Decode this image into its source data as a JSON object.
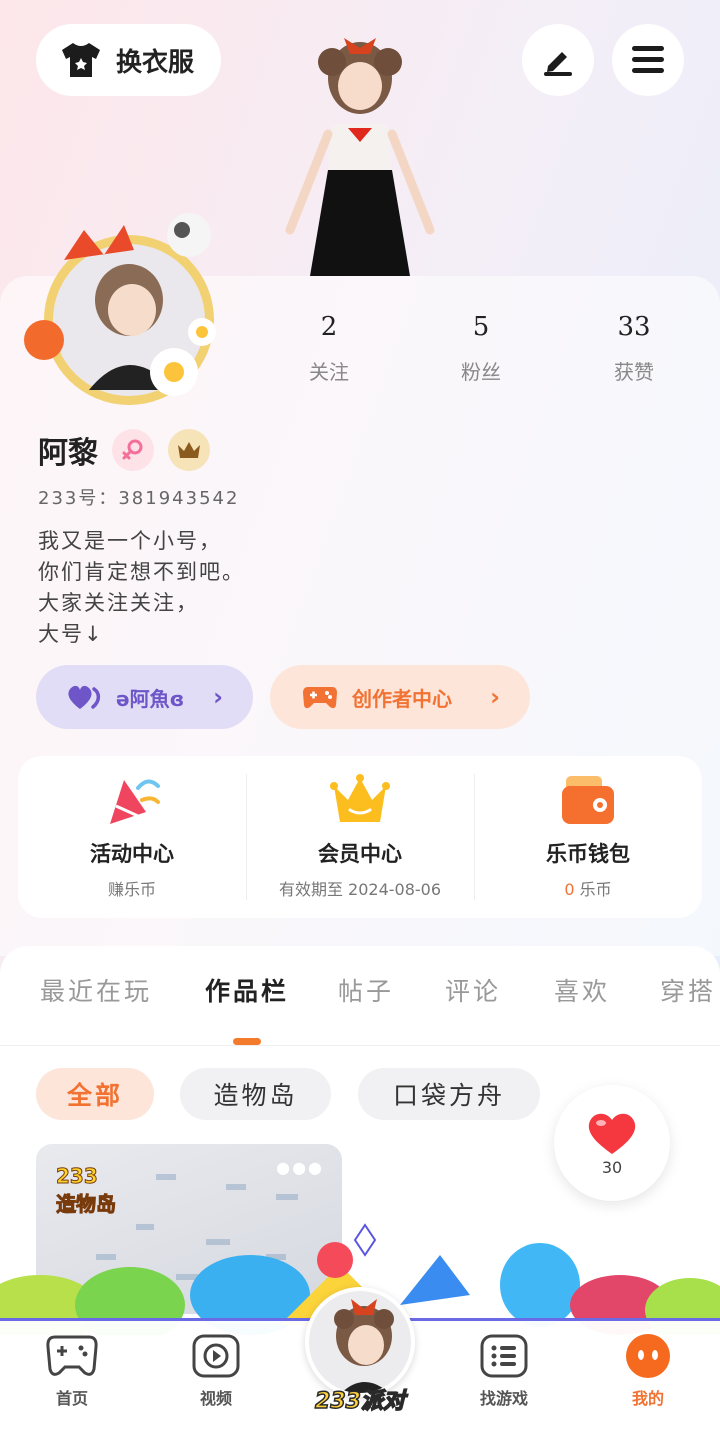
{
  "header": {
    "outfit_label": "换衣服",
    "icons": [
      "tshirt-icon",
      "edit-icon",
      "menu-icon"
    ]
  },
  "profile": {
    "stats": [
      {
        "value": "2",
        "label": "关注"
      },
      {
        "value": "5",
        "label": "粉丝"
      },
      {
        "value": "33",
        "label": "获赞"
      }
    ],
    "name": "阿黎",
    "uid": "233号：381943542",
    "bio": [
      "我又是一个小号，",
      "你们肯定想不到吧。",
      "大家关注关注，",
      "大号↓"
    ],
    "partner_label": "ə阿魚ɞ",
    "creator_label": "创作者中心"
  },
  "services": [
    {
      "title": "活动中心",
      "sub": "赚乐币",
      "icon": "party-popper-icon"
    },
    {
      "title": "会员中心",
      "sub": "有效期至 2024-08-06",
      "icon": "crown-icon"
    },
    {
      "title": "乐币钱包",
      "sub_value": "0",
      "sub_unit": "乐币",
      "icon": "wallet-icon"
    }
  ],
  "tabs": [
    "最近在玩",
    "作品栏",
    "帖子",
    "评论",
    "喜欢",
    "穿搭"
  ],
  "active_tab": "作品栏",
  "chips": [
    "全部",
    "造物岛",
    "口袋方舟"
  ],
  "like_count": "30",
  "work_card": {
    "logo_top": "233",
    "logo_bottom": "造物岛"
  },
  "bottom_nav": [
    {
      "label": "首页",
      "icon": "gamepad-icon"
    },
    {
      "label": "视频",
      "icon": "play-icon"
    },
    {
      "label": "233派对",
      "icon": "avatar"
    },
    {
      "label": "找游戏",
      "icon": "list-icon"
    },
    {
      "label": "我的",
      "icon": "profile-icon"
    }
  ],
  "colors": {
    "accent": "#f17232",
    "purple": "#6e55c8",
    "nav_border": "#6b6ae6"
  }
}
